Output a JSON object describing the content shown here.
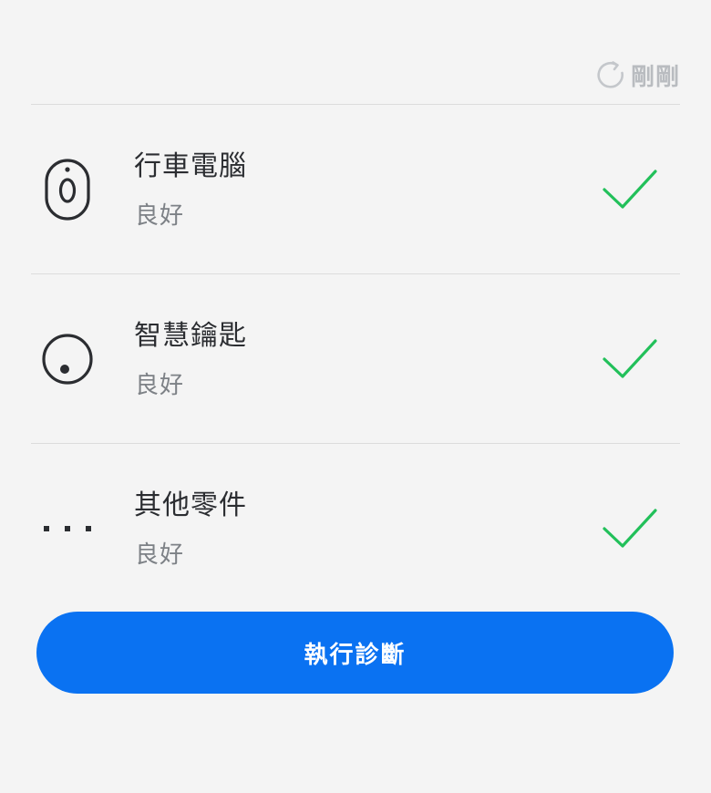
{
  "header": {
    "refresh_label": "剛剛",
    "refresh_icon": "refresh-icon"
  },
  "diagnostics": {
    "items": [
      {
        "name": "行車電腦",
        "status": "良好",
        "icon": "car-computer-icon"
      },
      {
        "name": "智慧鑰匙",
        "status": "良好",
        "icon": "smart-key-icon"
      },
      {
        "name": "其他零件",
        "status": "良好",
        "icon": "more-dots-icon"
      }
    ]
  },
  "action": {
    "run_label": "執行診斷"
  },
  "colors": {
    "background": "#f4f4f4",
    "accent": "#0a72f2",
    "success": "#22c05a",
    "muted": "#b9bcc0",
    "text": "#2b2d31",
    "subtext": "#7d8186"
  }
}
